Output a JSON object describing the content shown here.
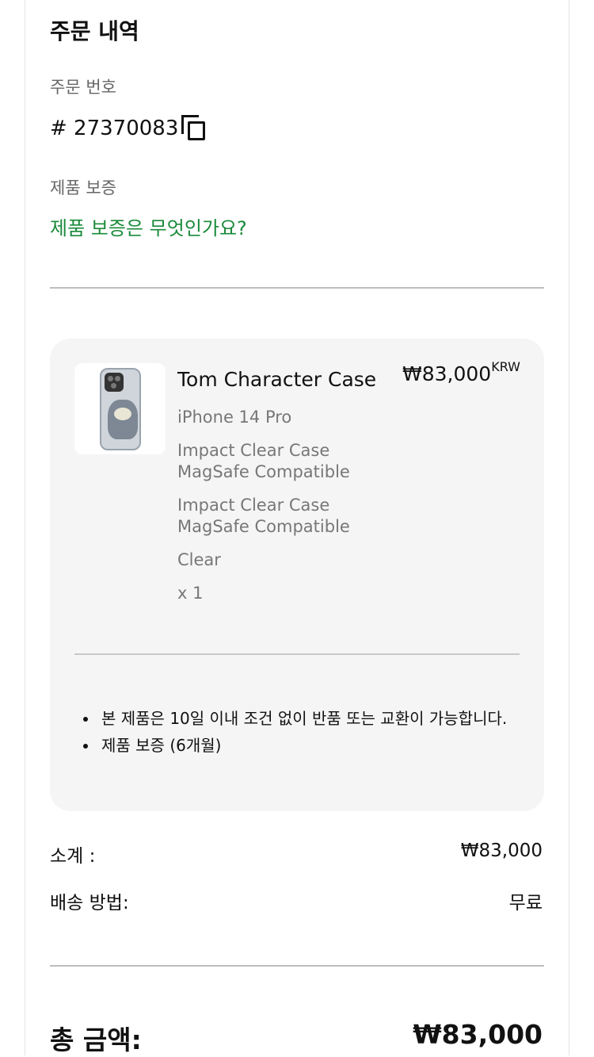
{
  "header": {
    "title": "주문 내역"
  },
  "order": {
    "number_label": "주문 번호",
    "number_value": "# 27370083",
    "warranty_label": "제품 보증",
    "warranty_link": "제품 보증은 무엇인가요?"
  },
  "item": {
    "name": "Tom Character Case",
    "price": "₩83,000",
    "currency": "KRW",
    "options": [
      "iPhone 14 Pro",
      "Impact Clear Case",
      "MagSafe Compatible",
      "Impact Clear Case",
      "MagSafe Compatible",
      "Clear",
      "x 1"
    ],
    "notes": [
      "본 제품은 10일 이내 조건 없이 반품 또는 교환이 가능합니다.",
      "제품 보증 (6개월)"
    ]
  },
  "summary": {
    "subtotal_label": "소계 :",
    "subtotal_value": "₩83,000",
    "shipping_label": "배송 방법:",
    "shipping_value": "무료",
    "total_label": "총 금액:",
    "total_value": "₩83,000"
  },
  "colors": {
    "link": "#1a8a3a",
    "card_bg": "#f5f5f5",
    "divider": "#bdbdbd"
  },
  "icons": {
    "copy": "copy-icon",
    "bullet": "bullet-dot-icon"
  }
}
